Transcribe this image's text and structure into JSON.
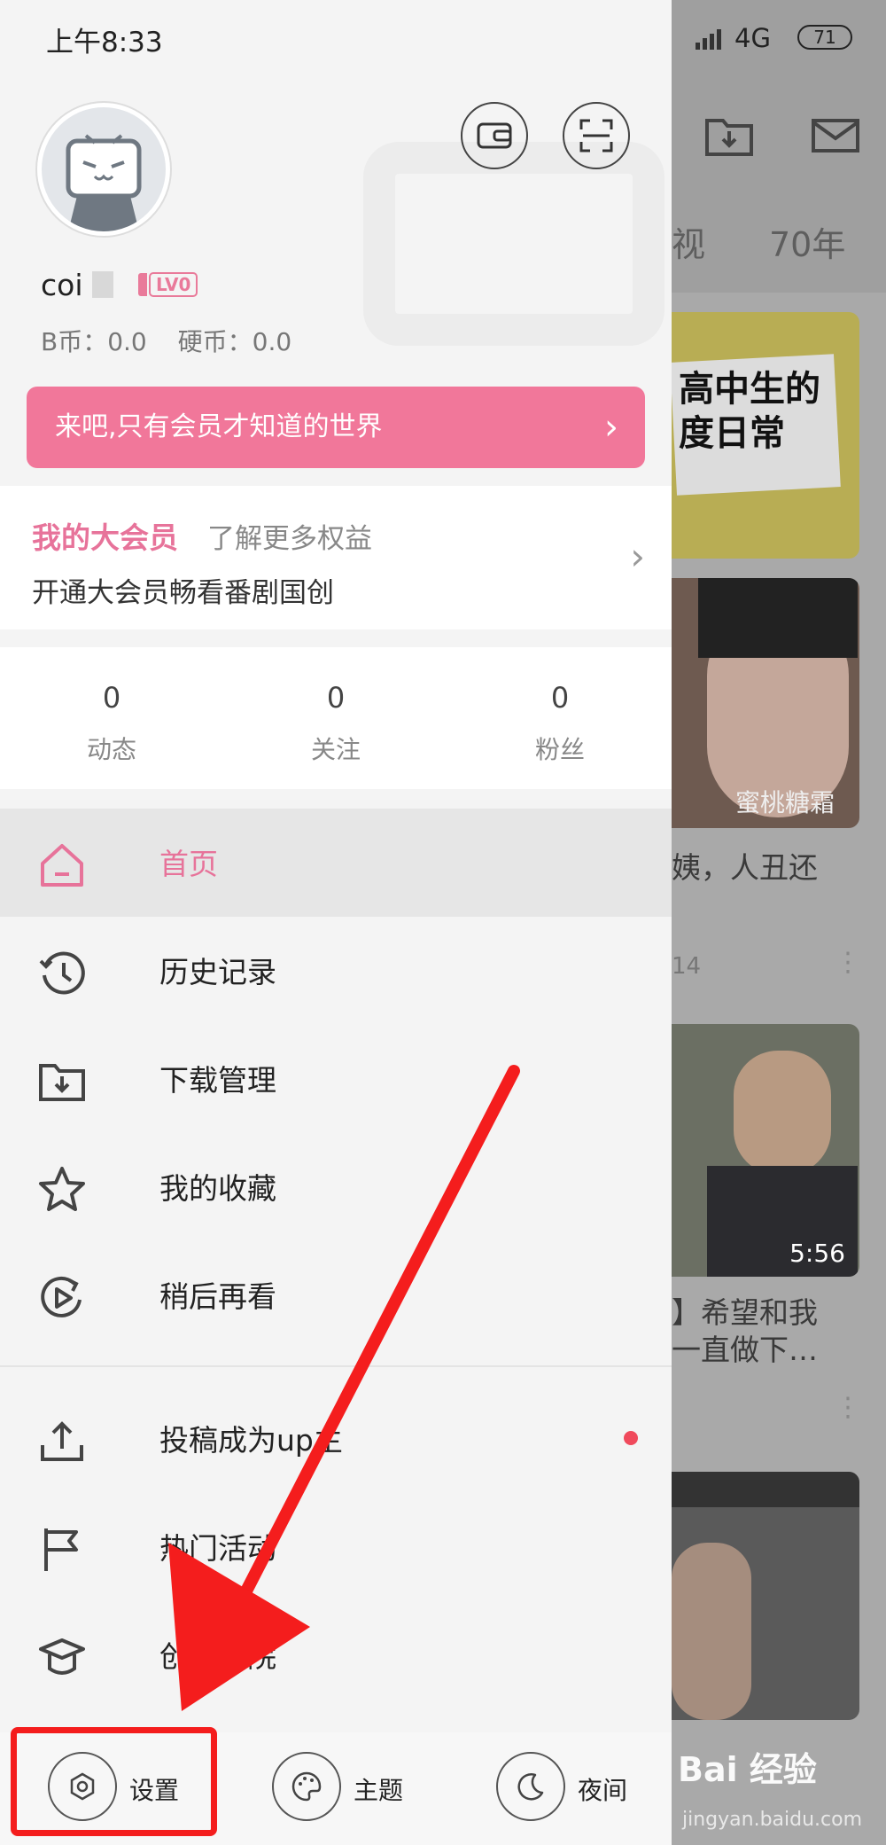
{
  "status_bar": {
    "time": "上午8:33",
    "network": "4G",
    "battery": "71"
  },
  "profile": {
    "username": "coi",
    "level": "LV0",
    "b_coins": "B币：0.0",
    "coins": "硬币：0.0"
  },
  "vip_banner": {
    "text": "来吧,只有会员才知道的世界",
    "chevron": "›"
  },
  "vip_card": {
    "title": "我的大会员",
    "more": "了解更多权益",
    "desc": "开通大会员畅看番剧国创",
    "chevron": "›"
  },
  "stats": [
    {
      "value": "0",
      "label": "动态"
    },
    {
      "value": "0",
      "label": "关注"
    },
    {
      "value": "0",
      "label": "粉丝"
    }
  ],
  "menu": [
    {
      "label": "首页",
      "icon": "home-icon",
      "active": true
    },
    {
      "label": "历史记录",
      "icon": "history-icon"
    },
    {
      "label": "下载管理",
      "icon": "download-icon"
    },
    {
      "label": "我的收藏",
      "icon": "star-icon"
    },
    {
      "label": "稍后再看",
      "icon": "watch-later-icon"
    },
    {
      "label": "投稿成为up主",
      "icon": "upload-icon",
      "badge": "red-dot"
    },
    {
      "label": "热门活动",
      "icon": "flag-icon"
    },
    {
      "label": "创作学院",
      "icon": "graduation-cap-icon"
    }
  ],
  "bottom_bar": [
    {
      "label": "设置",
      "icon": "gear-icon"
    },
    {
      "label": "主题",
      "icon": "palette-icon"
    },
    {
      "label": "夜间",
      "icon": "moon-icon"
    }
  ],
  "background": {
    "tabs": [
      "视",
      "70年"
    ],
    "cards": [
      {
        "thumb_title": "高中生的",
        "thumb_subtitle": "度日常"
      },
      {
        "caption": "蜜桃糖霜",
        "title": "姨，人丑还",
        "meta": "14"
      },
      {
        "duration": "5:56",
        "title_line1": "】希望和我",
        "title_line2": "一直做下…"
      },
      {}
    ],
    "watermark": "Bai 经验",
    "watermark_url": "jingyan.baidu.com"
  },
  "colors": {
    "accent": "#f1779a",
    "annotation": "#f41d1d"
  }
}
